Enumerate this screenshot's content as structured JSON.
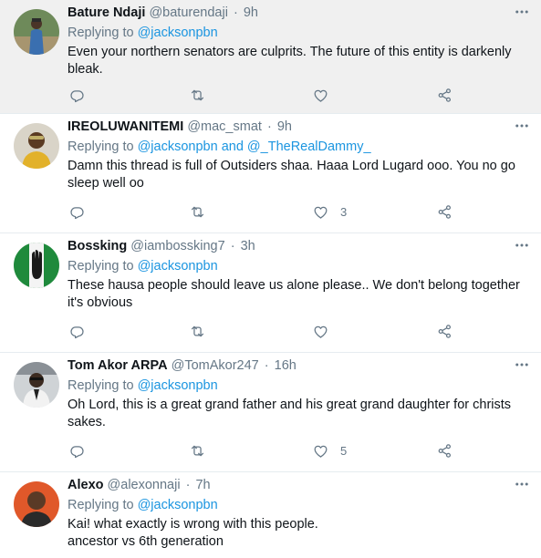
{
  "replying_label": "Replying to",
  "tweets": [
    {
      "name": "Bature Ndaji",
      "handle": "@baturendaji",
      "sep": "·",
      "time": "9h",
      "mention1": "@jacksonpbn",
      "and_label": "",
      "mention2": "",
      "text_lines": [
        "Even your northern senators are culprits. The future of this entity is darkenly bleak.",
        ""
      ],
      "likes": ""
    },
    {
      "name": "IREOLUWANITEMI",
      "handle": "@mac_smat",
      "sep": "·",
      "time": "9h",
      "mention1": "@jacksonpbn",
      "and_label": "and",
      "mention2": "@_TheRealDammy_",
      "text_lines": [
        "Damn this thread is full of Outsiders shaa. Haaa Lord Lugard ooo. You no go sleep well oo",
        ""
      ],
      "likes": "3"
    },
    {
      "name": "Bossking",
      "handle": "@iambossking7",
      "sep": "·",
      "time": "3h",
      "mention1": "@jacksonpbn",
      "and_label": "",
      "mention2": "",
      "text_lines": [
        "These hausa people should leave us alone please.. We don't belong together it's obvious",
        ""
      ],
      "likes": ""
    },
    {
      "name": "Tom Akor ARPA",
      "handle": "@TomAkor247",
      "sep": "·",
      "time": "16h",
      "mention1": "@jacksonpbn",
      "and_label": "",
      "mention2": "",
      "text_lines": [
        "Oh Lord, this is a great grand father and his great grand daughter for christs sakes.",
        ""
      ],
      "likes": "5"
    },
    {
      "name": "Alexo",
      "handle": "@alexonnaji",
      "sep": "·",
      "time": "7h",
      "mention1": "@jacksonpbn",
      "and_label": "",
      "mention2": "",
      "text_lines": [
        "Kai! what exactly is wrong with this people.",
        "ancestor vs 6th generation"
      ],
      "likes": ""
    }
  ],
  "colors": {
    "name": "#0f1419",
    "muted": "#657786",
    "link": "#1b95e0",
    "highlight_bg": "#f0f0f0",
    "divider": "#e6ecf0"
  },
  "icons": [
    "reply-icon",
    "retweet-icon",
    "like-icon",
    "share-icon",
    "more-icon"
  ]
}
